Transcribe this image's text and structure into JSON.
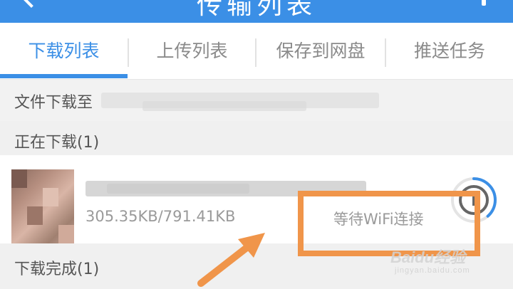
{
  "header": {
    "title": "传输列表"
  },
  "tabs": [
    {
      "label": "下载列表",
      "active": true
    },
    {
      "label": "上传列表",
      "active": false
    },
    {
      "label": "保存到网盘",
      "active": false
    },
    {
      "label": "推送任务",
      "active": false
    }
  ],
  "path_label": "文件下载至",
  "sections": {
    "downloading": "正在下载(1)",
    "completed": "下载完成(1)"
  },
  "download_item": {
    "progress": "305.35KB/791.41KB",
    "progress_fraction": 0.386,
    "status": "等待WiFi连接"
  },
  "colors": {
    "accent": "#3b8fe6",
    "highlight": "#f0954a"
  },
  "watermark": {
    "brand": "Baidu经验",
    "url": "jingyan.baidu.com"
  }
}
